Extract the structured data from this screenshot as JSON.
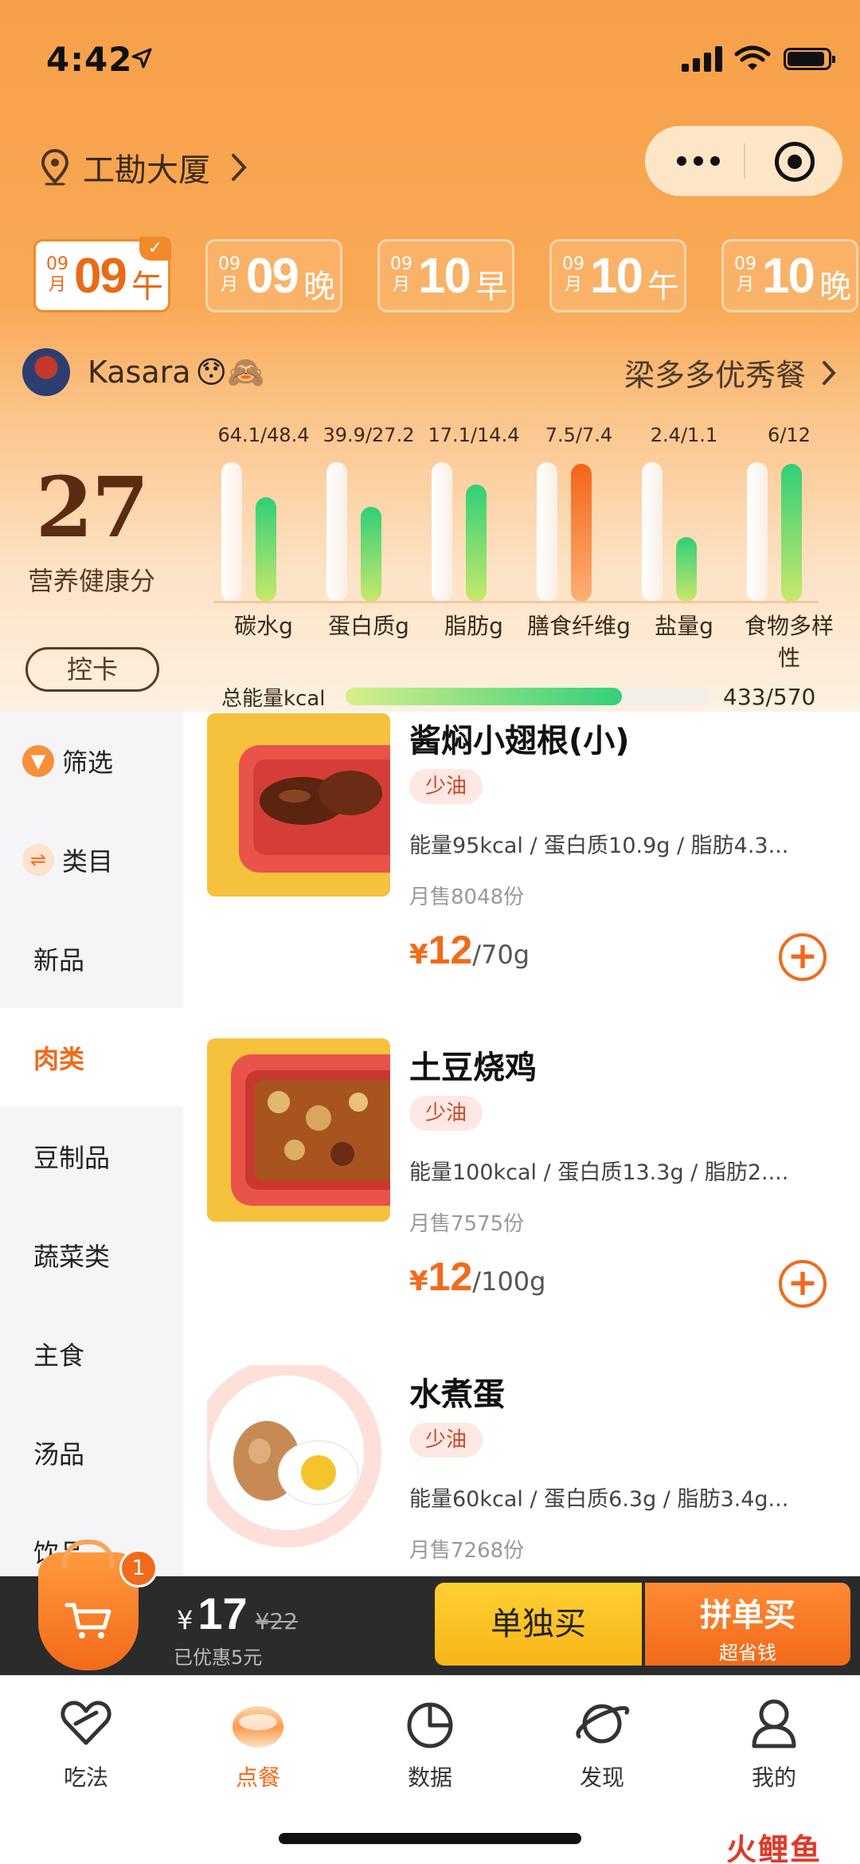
{
  "status_bar": {
    "time": "4:42"
  },
  "location": {
    "name": "工勘大厦"
  },
  "dates": [
    {
      "month_top": "09",
      "month_bottom": "月",
      "day": "09",
      "meal": "午",
      "selected": true
    },
    {
      "month_top": "09",
      "month_bottom": "月",
      "day": "09",
      "meal": "晚",
      "selected": false
    },
    {
      "month_top": "09",
      "month_bottom": "月",
      "day": "10",
      "meal": "早",
      "selected": false
    },
    {
      "month_top": "09",
      "month_bottom": "月",
      "day": "10",
      "meal": "午",
      "selected": false
    },
    {
      "month_top": "09",
      "month_bottom": "月",
      "day": "10",
      "meal": "晚",
      "selected": false
    }
  ],
  "user": {
    "name": "Kasara",
    "emojis": "😯🙈",
    "group_link": "梁多多优秀餐"
  },
  "health": {
    "score": "27",
    "label": "营养健康分",
    "control_button": "控卡"
  },
  "nutrients": [
    {
      "name": "碳水g",
      "value_text": "64.1/48.4",
      "ratio": 0.75
    },
    {
      "name": "蛋白质g",
      "value_text": "39.9/27.2",
      "ratio": 0.68
    },
    {
      "name": "脂肪g",
      "value_text": "17.1/14.4",
      "ratio": 0.84
    },
    {
      "name": "膳食纤维g",
      "value_text": "7.5/7.4",
      "ratio": 0.99,
      "over": true
    },
    {
      "name": "盐量g",
      "value_text": "2.4/1.1",
      "ratio": 0.46
    },
    {
      "name": "食物多样性",
      "value_text": "6/12",
      "ratio": 0.99
    }
  ],
  "energy": {
    "label": "总能量kcal",
    "value_text": "433/570",
    "ratio": 0.76
  },
  "sidebar": {
    "filter_label": "筛选",
    "category_label": "类目",
    "items": [
      "新品",
      "肉类",
      "豆制品",
      "蔬菜类",
      "主食",
      "汤品",
      "饮品"
    ],
    "active_index": 1
  },
  "products": [
    {
      "title": "酱焖小翅根(小)",
      "tag": "少油",
      "nutrition": "能量95kcal / 蛋白质10.9g / 脂肪4.3...",
      "sales": "月售8048份",
      "currency": "¥",
      "price": "12",
      "unit": "/70g"
    },
    {
      "title": "土豆烧鸡",
      "tag": "少油",
      "nutrition": "能量100kcal / 蛋白质13.3g / 脂肪2....",
      "sales": "月售7575份",
      "currency": "¥",
      "price": "12",
      "unit": "/100g"
    },
    {
      "title": "水煮蛋",
      "tag": "少油",
      "nutrition": "能量60kcal / 蛋白质6.3g / 脂肪3.4g...",
      "sales": "月售7268份",
      "currency": "¥",
      "price": "",
      "unit": ""
    }
  ],
  "cart": {
    "count": "1",
    "currency": "¥",
    "total": "17",
    "original": "¥22",
    "saved": "已优惠5元",
    "buy_alone": "单独买",
    "buy_group": "拼单买",
    "buy_group_sub": "超省钱"
  },
  "tabs": [
    {
      "label": "吃法",
      "icon": "heart-icon"
    },
    {
      "label": "点餐",
      "icon": "order-icon",
      "active": true
    },
    {
      "label": "数据",
      "icon": "pie-chart-icon"
    },
    {
      "label": "发现",
      "icon": "planet-icon"
    },
    {
      "label": "我的",
      "icon": "user-icon"
    }
  ],
  "watermark": "火鲤鱼",
  "colors": {
    "accent": "#f26a1b",
    "header": "#f7a04a",
    "nutrient_ok": "#2fcf78",
    "nutrient_over": "#f3651a"
  }
}
